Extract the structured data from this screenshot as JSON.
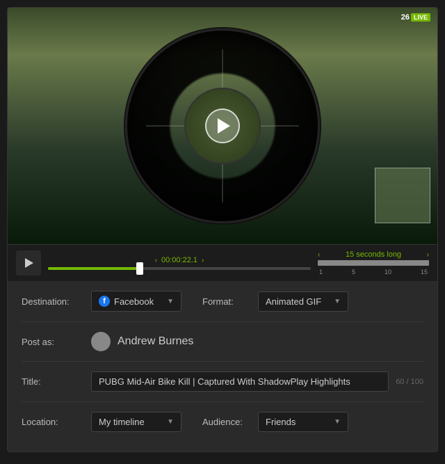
{
  "video": {
    "hud": {
      "level": "26",
      "badge": "LIVE"
    },
    "controls": {
      "play_label": "Play",
      "time_display": "00:00:22.1",
      "gif_duration": "15 seconds long",
      "ruler_ticks": [
        "1",
        "5",
        "10",
        "15"
      ]
    }
  },
  "form": {
    "destination_label": "Destination:",
    "destination_value": "Facebook",
    "format_label": "Format:",
    "format_value": "Animated GIF",
    "post_as_label": "Post as:",
    "post_as_value": "Andrew Burnes",
    "title_label": "Title:",
    "title_value": "PUBG Mid-Air Bike Kill | Captured With ShadowPlay Highlights",
    "title_char_count": "60 / 100",
    "location_label": "Location:",
    "location_value": "My timeline",
    "audience_label": "Audience:",
    "audience_value": "Friends"
  }
}
